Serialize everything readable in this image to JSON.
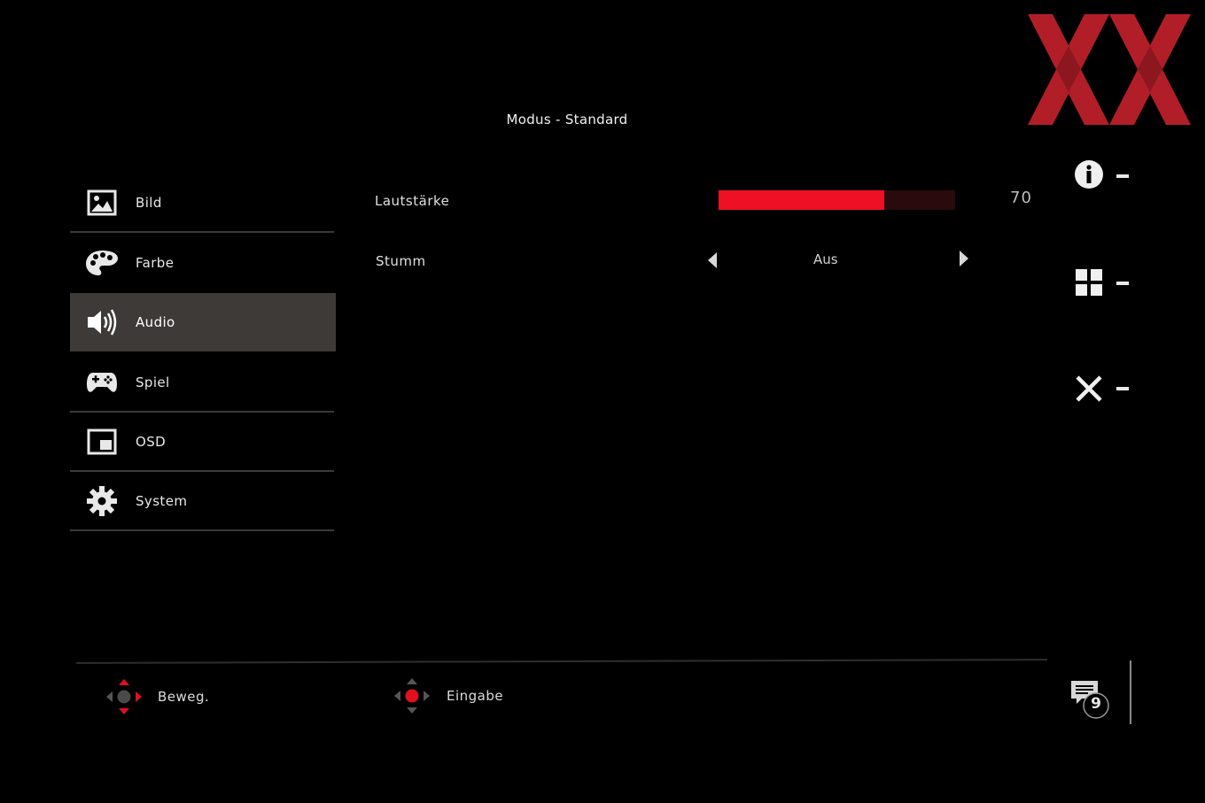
{
  "title": "Modus - Standard",
  "logo": {
    "name": "XX",
    "color": "#b21e27"
  },
  "menu": {
    "items": [
      {
        "label": "Bild",
        "icon": "picture-icon"
      },
      {
        "label": "Farbe",
        "icon": "palette-icon"
      },
      {
        "label": "Audio",
        "icon": "speaker-icon",
        "active": true
      },
      {
        "label": "Spiel",
        "icon": "gamepad-icon"
      },
      {
        "label": "OSD",
        "icon": "osd-window-icon"
      },
      {
        "label": "System",
        "icon": "gear-icon"
      }
    ]
  },
  "settings": {
    "volume": {
      "label": "Lautstärke",
      "value": "70",
      "level": 0.7,
      "color": "#ee1126"
    },
    "mute": {
      "label": "Stumm",
      "value": "Aus"
    }
  },
  "right_keys": [
    {
      "icon": "info-icon",
      "value": "-"
    },
    {
      "icon": "grid-icon",
      "value": "-"
    },
    {
      "icon": "close-icon",
      "value": "-"
    }
  ],
  "hints": {
    "move": {
      "label": "Beweg.",
      "icon": "joystick-move-icon"
    },
    "enter": {
      "label": "Eingabe",
      "icon": "joystick-press-icon"
    }
  },
  "notification": {
    "count": "9",
    "icon": "message-icon"
  },
  "colors": {
    "accent": "#ee1126",
    "active_bg": "#3d3a37"
  }
}
